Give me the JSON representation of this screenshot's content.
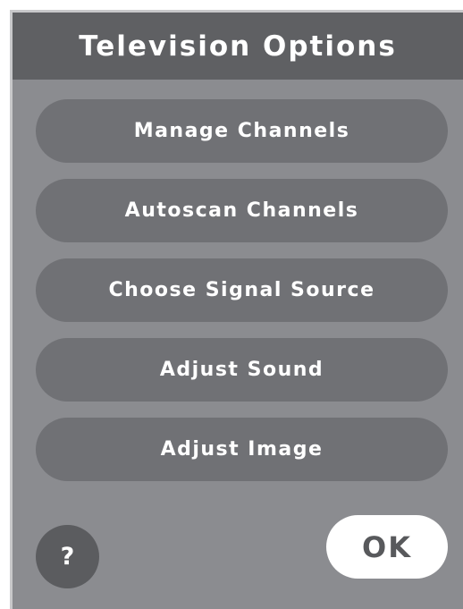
{
  "dialog": {
    "title": "Television Options"
  },
  "menu": {
    "items": [
      {
        "label": "Manage Channels"
      },
      {
        "label": "Autoscan Channels"
      },
      {
        "label": "Choose Signal Source"
      },
      {
        "label": "Adjust Sound"
      },
      {
        "label": "Adjust Image"
      }
    ]
  },
  "footer": {
    "help_label": "?",
    "ok_label": "OK"
  },
  "colors": {
    "panel_background": "#8b8c90",
    "title_bar": "#5f6063",
    "menu_button": "#707175",
    "help_button": "#5b5c5f",
    "ok_button": "#ffffff",
    "ok_text": "#58595c"
  }
}
